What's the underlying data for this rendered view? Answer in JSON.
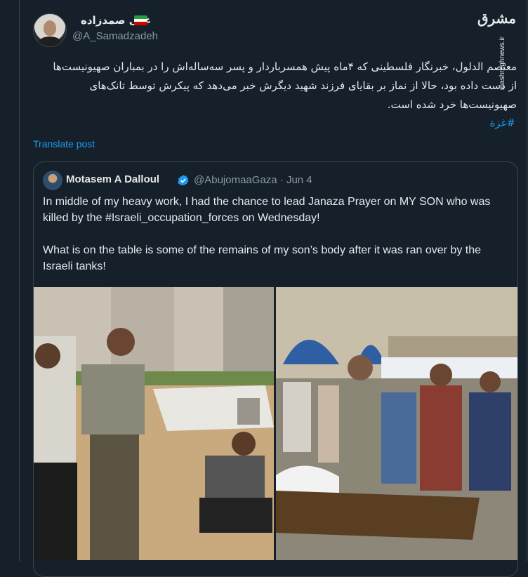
{
  "tweet": {
    "author_name": "علی صمدزاده",
    "author_handle": "@A_Samadzadeh",
    "text": "معتصم الدلول، خبرنگار فلسطینی که ۴ماه پیش همسرباردار و پسر سه‌ساله‌اش را در بمباران صهیونیست‌ها از دست داده بود، حالا از نماز بر بقایای فرزند شهید دیگرش خبر می‌دهد که پیکرش توسط تانک‌های صهیونیست‌ها خرد شده است.",
    "hashtag": "#غزة",
    "translate_label": "Translate post",
    "flag_colors": [
      "#239f40",
      "#ffffff",
      "#da0000"
    ]
  },
  "watermark": {
    "logo": "مشرق",
    "url": "mashreghnews.ir"
  },
  "quoted_tweet": {
    "author_name": "Motasem A Dalloul",
    "author_handle": "@AbujomaaGaza",
    "date": "· Jun 4",
    "paragraph1": "In middle of my heavy work, I had the chance to lead Janaza Prayer on MY SON who was killed by the #Israeli_occupation_forces on Wednesday!",
    "paragraph2": "What is on the table is some of the remains of my son’s body after it was ran over by the Israeli tanks!",
    "verified_color": "#1d9bf0"
  },
  "theme": {
    "background": "#15202b",
    "text": "#e7e9ea",
    "muted": "#8b98a5",
    "accent": "#1d9bf0",
    "border": "#38444d"
  }
}
